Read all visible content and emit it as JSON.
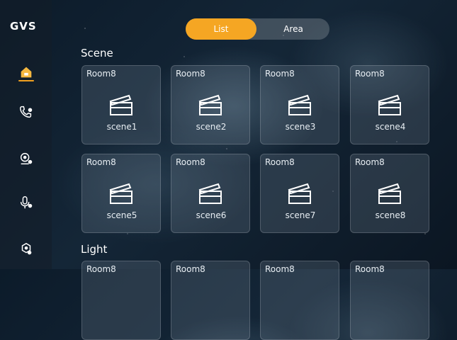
{
  "app": {
    "logo": "GVS"
  },
  "sidebar": {
    "items": [
      {
        "name": "home",
        "icon": "home-icon",
        "active": true
      },
      {
        "name": "phone",
        "icon": "phone-settings-icon"
      },
      {
        "name": "camera",
        "icon": "camera-icon"
      },
      {
        "name": "mic",
        "icon": "microphone-icon"
      },
      {
        "name": "settings",
        "icon": "gear-icon"
      }
    ]
  },
  "toggle": {
    "list": "List",
    "area": "Area",
    "active": "List"
  },
  "sections": {
    "scene": "Scene",
    "light": "Light"
  },
  "scenes": [
    {
      "room": "Room8",
      "name": "scene1"
    },
    {
      "room": "Room8",
      "name": "scene2"
    },
    {
      "room": "Room8",
      "name": "scene3"
    },
    {
      "room": "Room8",
      "name": "scene4"
    },
    {
      "room": "Room8",
      "name": "scene5"
    },
    {
      "room": "Room8",
      "name": "scene6"
    },
    {
      "room": "Room8",
      "name": "scene7"
    },
    {
      "room": "Room8",
      "name": "scene8"
    }
  ],
  "lights": [
    {
      "room": "Room8"
    },
    {
      "room": "Room8"
    },
    {
      "room": "Room8"
    },
    {
      "room": "Room8"
    }
  ],
  "colors": {
    "accent": "#f5a623"
  }
}
